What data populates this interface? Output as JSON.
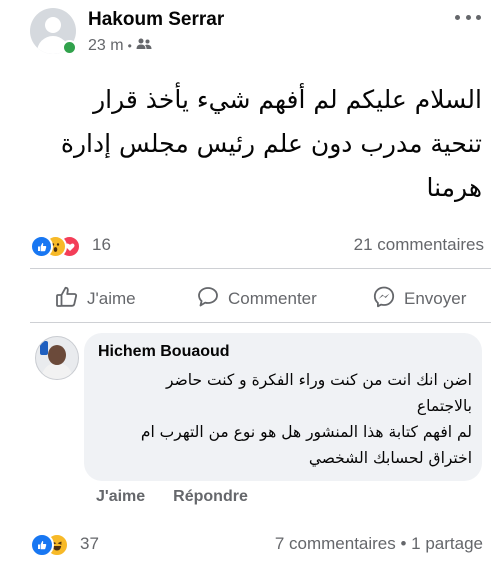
{
  "post": {
    "author": "Hakoum Serrar",
    "time": "23 m",
    "separator": "•",
    "audience_icon": "friends-icon",
    "more_icon": "more-options-icon",
    "text_lines": [
      "السلام عليكم  لم أفهم شيء يأخذ قرار",
      "تنحية مدرب دون علم رئيس مجلس إدارة",
      "هرمنا"
    ],
    "reactions": {
      "icons": [
        "like-icon",
        "wow-icon",
        "love-icon"
      ],
      "count": "16"
    },
    "comments_count": "21 commentaires"
  },
  "actions": {
    "like": "J'aime",
    "comment": "Commenter",
    "send": "Envoyer"
  },
  "comment": {
    "author": "Hichem Bouaoud",
    "text_lines": [
      "اضن انك انت من كنت وراء الفكرة و كنت حاضر",
      "بالاجتماع",
      "لم افهم كتابة هذا المنشور هل هو نوع من التهرب ام",
      "اختراق لحسابك الشخصي"
    ],
    "like_label": "J'aime",
    "reply_label": "Répondre"
  },
  "footer": {
    "reaction_icons": [
      "like-icon",
      "haha-icon"
    ],
    "reaction_count": "37",
    "comments": "7 commentaires • 1 partage"
  },
  "colors": {
    "like_blue": "#1877f2",
    "love_red": "#f33e58",
    "wow_yellow": "#f7b928",
    "online_green": "#31a24c",
    "secondary_text": "#65676b",
    "bubble_bg": "#f0f2f5"
  }
}
